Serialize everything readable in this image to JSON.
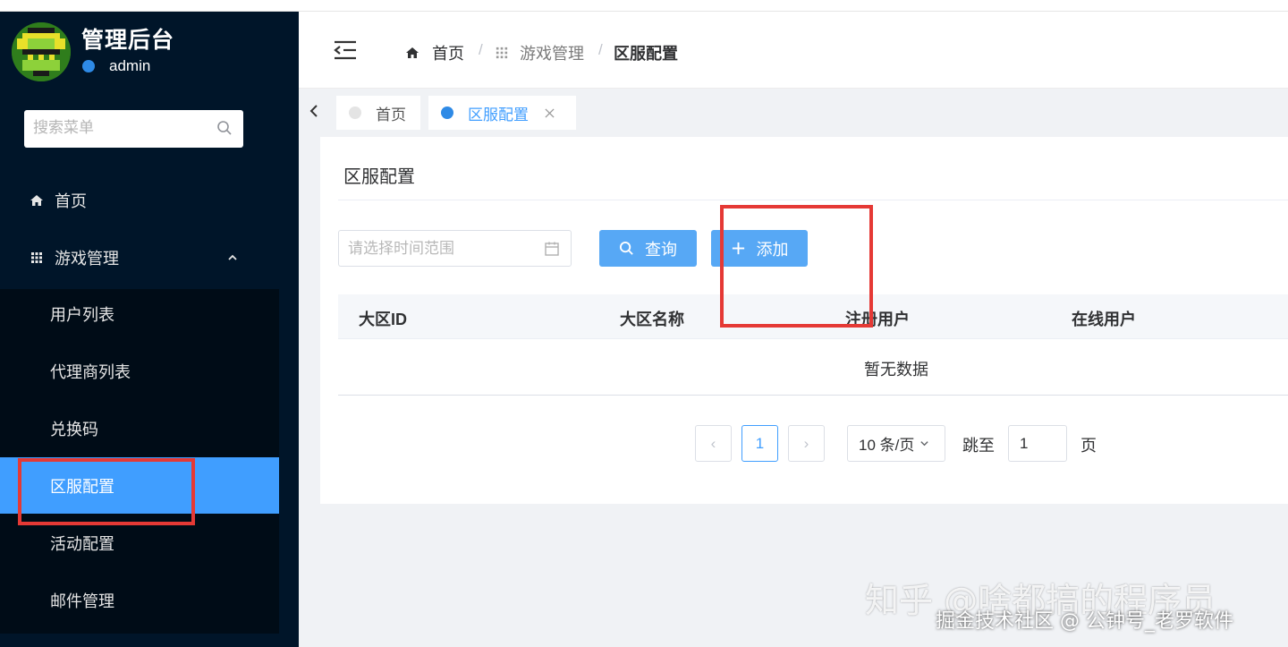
{
  "app": {
    "title": "管理后台",
    "username": "admin"
  },
  "sidebar": {
    "search_placeholder": "搜索菜单",
    "items": [
      {
        "label": "首页"
      },
      {
        "label": "游戏管理"
      },
      {
        "label": "用户列表"
      },
      {
        "label": "代理商列表"
      },
      {
        "label": "兑换码"
      },
      {
        "label": "区服配置"
      },
      {
        "label": "活动配置"
      },
      {
        "label": "邮件管理"
      }
    ],
    "active_item": "区服配置"
  },
  "breadcrumb": {
    "home": "首页",
    "section": "游戏管理",
    "current": "区服配置",
    "separator": "/"
  },
  "tags": [
    {
      "label": "首页"
    },
    {
      "label": "区服配置"
    }
  ],
  "card": {
    "title": "区服配置",
    "date_placeholder": "请选择时间范围",
    "query_label": "查询",
    "add_label": "添加"
  },
  "table": {
    "columns": [
      "大区ID",
      "大区名称",
      "注册用户",
      "在线用户"
    ],
    "empty_text": "暂无数据"
  },
  "pagination": {
    "prev": "‹",
    "next": "›",
    "current_page": "1",
    "page_size": "10 条/页",
    "jump_label": "跳至",
    "jump_value": "1",
    "page_unit": "页"
  },
  "watermark": {
    "line1": "知乎 @啥都搞的程序员",
    "line2": "掘金技术社区 @ 公钟号_老罗软件"
  },
  "colors": {
    "sidebar": "#001529",
    "accent": "#409eff",
    "button": "#57a8f5",
    "highlight": "#e53935"
  }
}
